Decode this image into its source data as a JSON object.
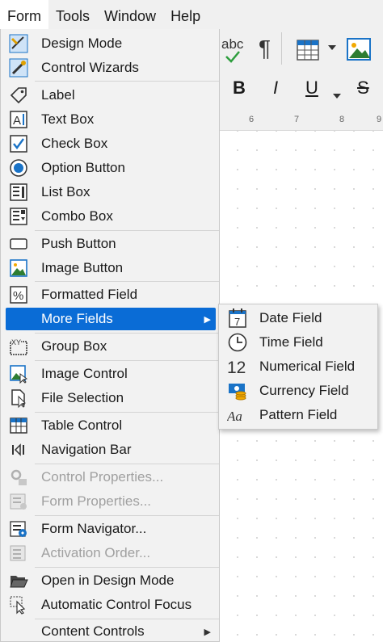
{
  "menubar": {
    "items": [
      {
        "label": "Form"
      },
      {
        "label": "Tools"
      },
      {
        "label": "Window"
      },
      {
        "label": "Help"
      }
    ]
  },
  "toolbar": {
    "spell_label": "abc",
    "pilcrow": "¶",
    "bold": "B",
    "italic": "I",
    "underline": "U",
    "strike": "S",
    "ruler_ticks": [
      "6",
      "7",
      "8",
      "9"
    ]
  },
  "menu": {
    "design_mode": "Design Mode",
    "control_wizards": "Control Wizards",
    "label": "Label",
    "text_box": "Text Box",
    "check_box": "Check Box",
    "option_button": "Option Button",
    "list_box": "List Box",
    "combo_box": "Combo Box",
    "push_button": "Push Button",
    "image_button": "Image Button",
    "formatted_field": "Formatted Field",
    "more_fields": "More Fields",
    "group_box": "Group Box",
    "image_control": "Image Control",
    "file_selection": "File Selection",
    "table_control": "Table Control",
    "navigation_bar": "Navigation Bar",
    "control_properties": "Control Properties...",
    "form_properties": "Form Properties...",
    "form_navigator": "Form Navigator...",
    "activation_order": "Activation Order...",
    "open_in_design_mode": "Open in Design Mode",
    "automatic_control_focus": "Automatic Control Focus",
    "content_controls": "Content Controls"
  },
  "submenu": {
    "date_field": "Date Field",
    "time_field": "Time Field",
    "numerical_field": "Numerical Field",
    "currency_field": "Currency Field",
    "pattern_field": "Pattern Field",
    "date_icon_text": "7",
    "numerical_icon_text": "12",
    "pattern_icon_text": "Aa"
  },
  "colors": {
    "highlight": "#0a6cd6",
    "icon_blue": "#1a73c7",
    "disabled": "#a0a0a0"
  }
}
